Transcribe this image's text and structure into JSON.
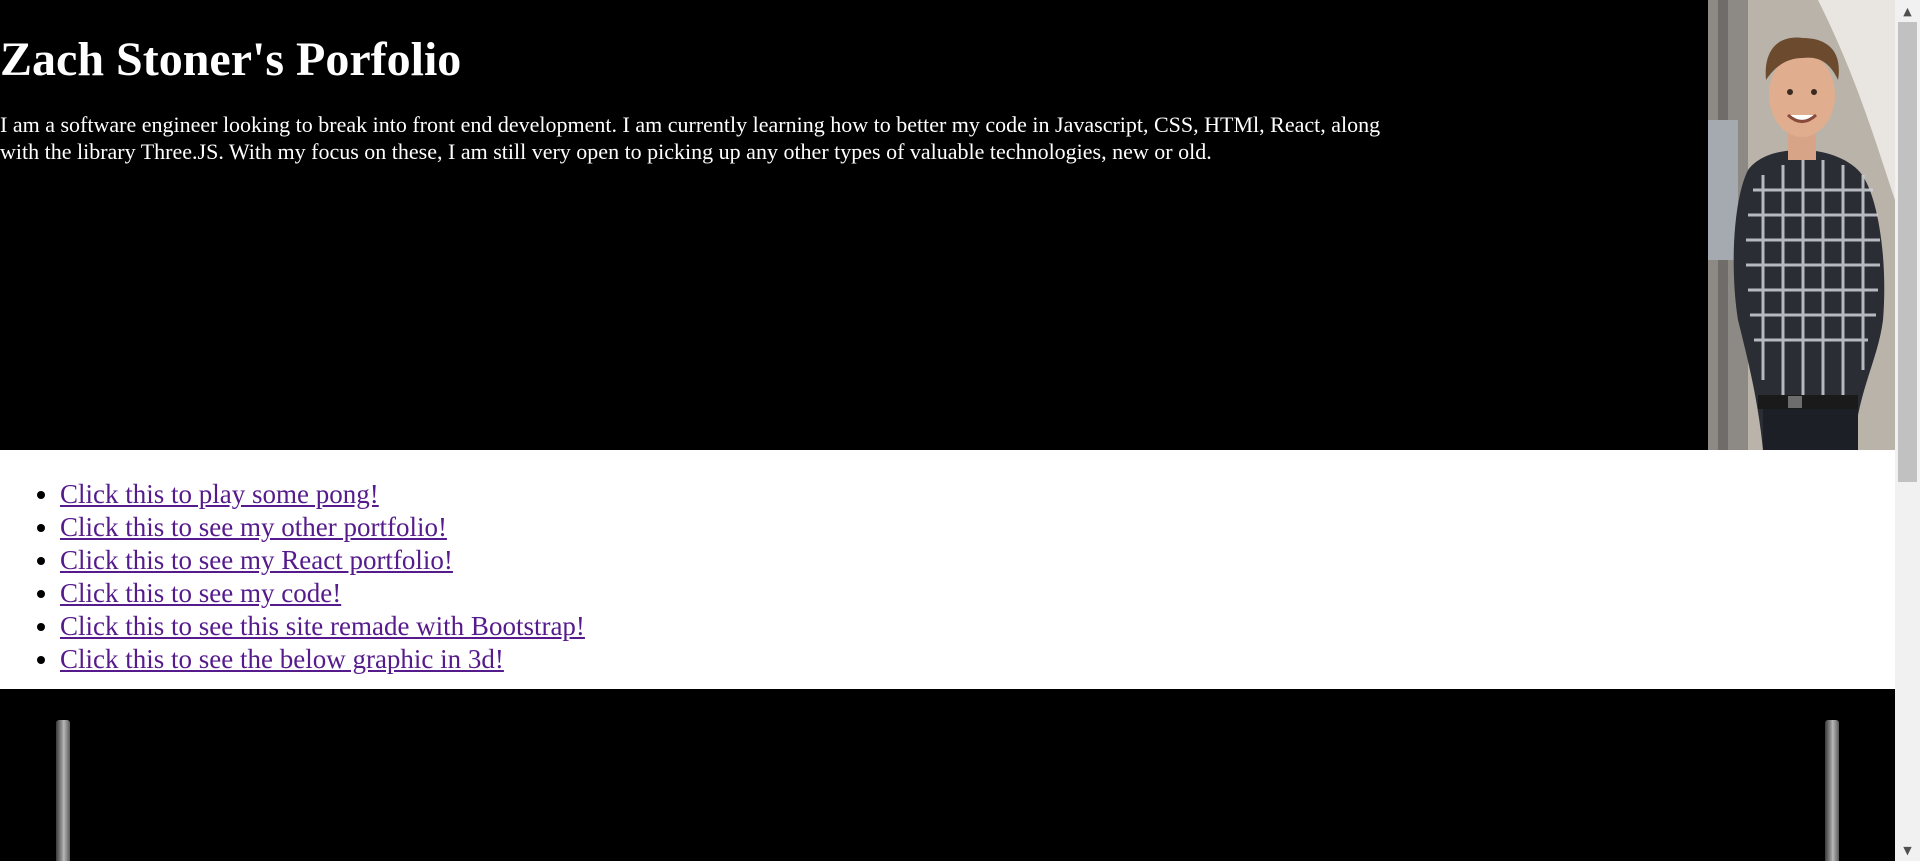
{
  "header": {
    "title": "Zach Stoner's Porfolio",
    "intro": "I am a software engineer looking to break into front end development. I am currently learning how to better my code in Javascript, CSS, HTMl, React, along with the library Three.JS. With my focus on these, I am still very open to picking up any other types of valuable technologies, new or old."
  },
  "links": [
    {
      "label": "Click this to play some pong!"
    },
    {
      "label": "Click this to see my other portfolio!"
    },
    {
      "label": "Click this to see my React portfolio!"
    },
    {
      "label": "Click this to see my code!"
    },
    {
      "label": "Click this to see this site remade with Bootstrap!"
    },
    {
      "label": "Click this to see the below graphic in 3d!"
    }
  ],
  "colors": {
    "header_bg": "#000000",
    "link_visited": "#551a8b",
    "graphic_bg": "#000000"
  },
  "scrollbar": {
    "up_icon": "scroll-up-arrow-icon",
    "down_icon": "scroll-down-arrow-icon"
  }
}
